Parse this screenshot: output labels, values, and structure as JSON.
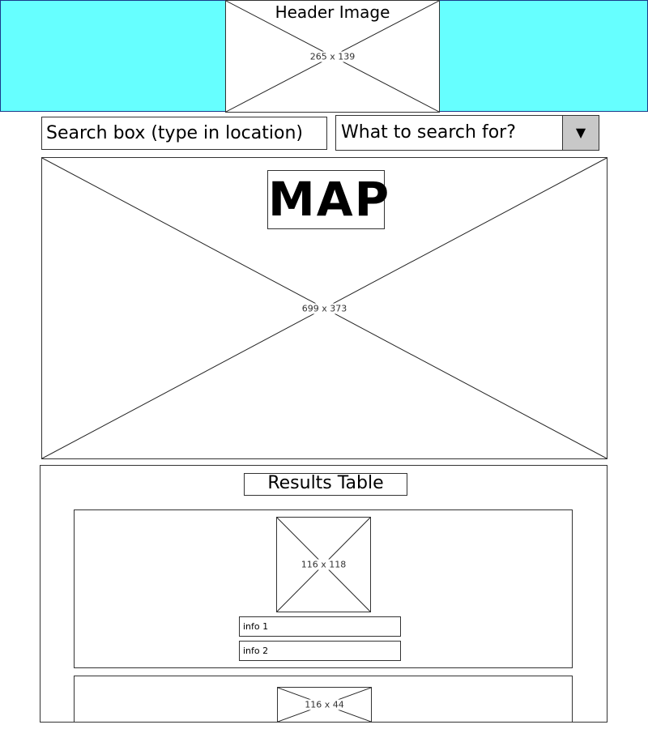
{
  "header": {
    "title": "Header Image",
    "image_dims": "265 x 139",
    "background_color": "#66ffff"
  },
  "search": {
    "location_placeholder": "Search box (type in location)",
    "category_select_value": "What to search for?",
    "dropdown_arrow": "▼"
  },
  "map": {
    "label": "MAP",
    "dims": "699 x 373"
  },
  "results": {
    "title": "Results Table",
    "cards": [
      {
        "thumb_dims": "116 x 118",
        "info_1": "info 1",
        "info_2": "info 2"
      },
      {
        "thumb_dims": "116 x 44"
      }
    ]
  }
}
